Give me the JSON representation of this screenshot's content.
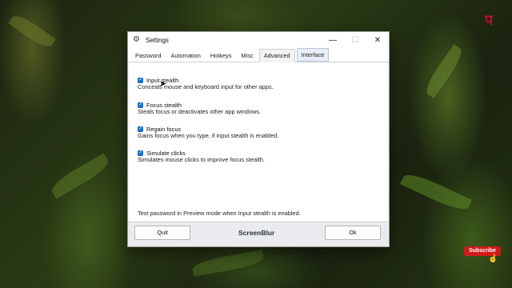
{
  "window": {
    "title": "Settings",
    "controls": {
      "minimize": "—",
      "maximize": "☐",
      "close": "✕"
    }
  },
  "tabs": [
    {
      "label": "Password"
    },
    {
      "label": "Automation"
    },
    {
      "label": "Hotkeys"
    },
    {
      "label": "Misc"
    },
    {
      "label": "Advanced"
    },
    {
      "label": "Interface"
    }
  ],
  "active_tab": "Advanced",
  "options": [
    {
      "label": "Input stealth",
      "description": "Conceals mouse and keyboard input for other apps.",
      "checked": true
    },
    {
      "label": "Focus stealth",
      "description": "Steals focus or deactivates other app windows.",
      "checked": true
    },
    {
      "label": "Regain focus",
      "description": "Gains focus when you type, if input stealth is enabled.",
      "checked": true
    },
    {
      "label": "Simulate clicks",
      "description": "Simulates mouse clicks to improve focus stealth.",
      "checked": true
    }
  ],
  "note": "Test password in Preview mode when Input stealth is enabled.",
  "footer": {
    "quit_label": "Quit",
    "brand": "ScreenBlur",
    "ok_label": "Ok"
  },
  "overlay": {
    "subscribe_label": "Subscribe"
  },
  "colors": {
    "accent": "#1a6fd0",
    "brand_text": "#2a3340",
    "subscribe": "#d11a1a"
  }
}
